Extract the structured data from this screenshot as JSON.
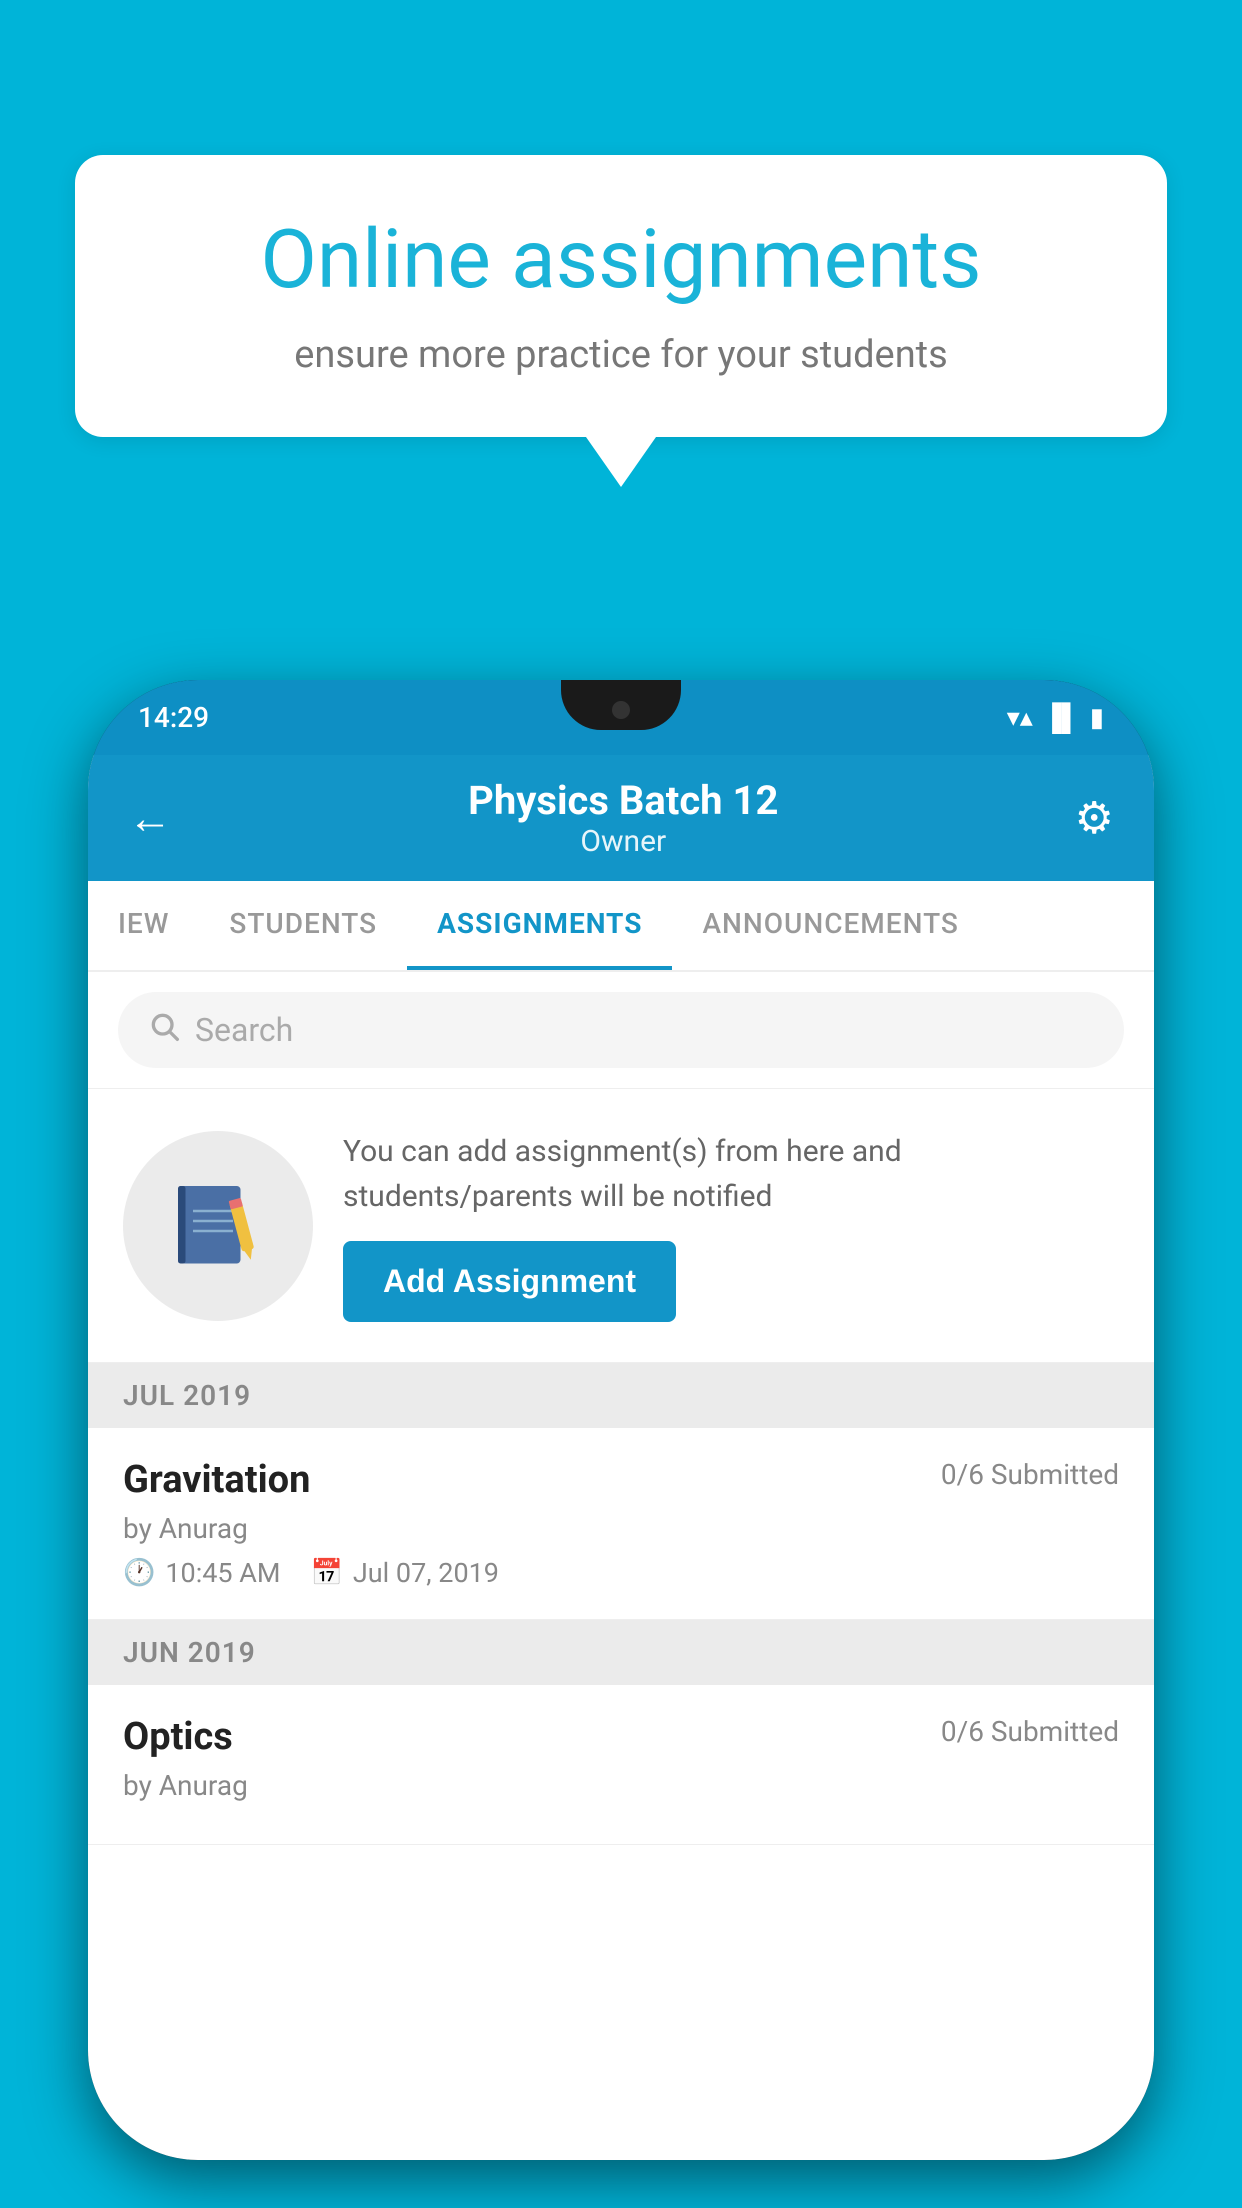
{
  "background": {
    "color": "#00b4d8"
  },
  "speech_bubble": {
    "title": "Online assignments",
    "subtitle": "ensure more practice for your students"
  },
  "phone": {
    "status_bar": {
      "time": "14:29",
      "icons": [
        "wifi",
        "signal",
        "battery"
      ]
    },
    "header": {
      "title": "Physics Batch 12",
      "subtitle": "Owner",
      "back_label": "←",
      "settings_label": "⚙"
    },
    "tabs": [
      {
        "label": "IEW",
        "active": false
      },
      {
        "label": "STUDENTS",
        "active": false
      },
      {
        "label": "ASSIGNMENTS",
        "active": true
      },
      {
        "label": "ANNOUNCEMENTS",
        "active": false
      }
    ],
    "search": {
      "placeholder": "Search"
    },
    "prompt": {
      "text": "You can add assignment(s) from here and students/parents will be notified",
      "button_label": "Add Assignment"
    },
    "sections": [
      {
        "label": "JUL 2019",
        "assignments": [
          {
            "name": "Gravitation",
            "submitted": "0/6 Submitted",
            "by": "by Anurag",
            "time": "10:45 AM",
            "date": "Jul 07, 2019"
          }
        ]
      },
      {
        "label": "JUN 2019",
        "assignments": [
          {
            "name": "Optics",
            "submitted": "0/6 Submitted",
            "by": "by Anurag",
            "time": "",
            "date": ""
          }
        ]
      }
    ]
  }
}
